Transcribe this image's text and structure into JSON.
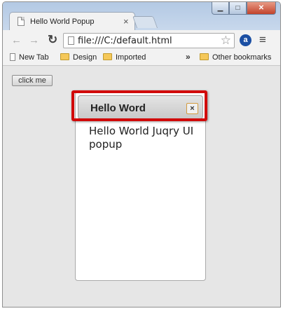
{
  "browser": {
    "tab_title": "Hello World Popup",
    "tab_close": "×",
    "address": "file:///C:/default.html",
    "icons": {
      "back": "arrow-left-icon",
      "forward": "arrow-right-icon",
      "reload": "reload-icon",
      "star": "star-icon",
      "extension": "a-icon",
      "menu": "menu-icon"
    },
    "extension_letter": "a",
    "bookmarks": [
      {
        "label": "New Tab",
        "icon": "page-icon"
      },
      {
        "label": "Design",
        "icon": "folder-icon"
      },
      {
        "label": "Imported",
        "icon": "folder-icon"
      }
    ],
    "overflow_chevrons": "»",
    "other_bookmarks": "Other bookmarks"
  },
  "page": {
    "button_label": "click me",
    "dialog": {
      "title": "Hello Word",
      "close_glyph": "×",
      "body": "Hello World Juqry UI popup",
      "highlight_color": "#d10a0a"
    }
  }
}
